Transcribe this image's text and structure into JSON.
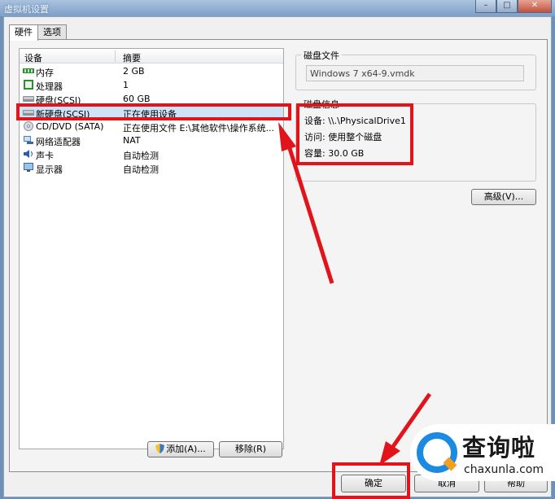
{
  "window": {
    "title": "虚拟机设置",
    "controls": {
      "minimize": "–",
      "maximize": "□",
      "close": "✕"
    }
  },
  "tabs": [
    {
      "label": "硬件",
      "active": true
    },
    {
      "label": "选项",
      "active": false
    }
  ],
  "device_list": {
    "headers": {
      "device": "设备",
      "summary": "摘要"
    },
    "rows": [
      {
        "icon": "memory-icon",
        "name": "内存",
        "summary": "2 GB"
      },
      {
        "icon": "processor-icon",
        "name": "处理器",
        "summary": "1"
      },
      {
        "icon": "hard-disk-icon",
        "name": "硬盘(SCSI)",
        "summary": "60 GB"
      },
      {
        "icon": "hard-disk-icon",
        "name": "新硬盘(SCSI)",
        "summary": "正在使用设备",
        "selected": true
      },
      {
        "icon": "cd-dvd-icon",
        "name": "CD/DVD (SATA)",
        "summary": "正在使用文件 E:\\其他软件\\操作系统..."
      },
      {
        "icon": "network-adapter-icon",
        "name": "网络适配器",
        "summary": "NAT"
      },
      {
        "icon": "sound-card-icon",
        "name": "声卡",
        "summary": "自动检测"
      },
      {
        "icon": "display-icon",
        "name": "显示器",
        "summary": "自动检测"
      }
    ]
  },
  "buttons": {
    "add": "添加(A)...",
    "remove": "移除(R)",
    "advanced": "高级(V)...",
    "ok": "确定",
    "cancel": "取消",
    "help": "帮助"
  },
  "disk_file": {
    "title": "磁盘文件",
    "value": "Windows 7 x64-9.vmdk"
  },
  "disk_info": {
    "title": "磁盘信息",
    "device": "设备:  \\\\.\\PhysicalDrive1",
    "access": "访问:  使用整个磁盘",
    "capacity": "容量:  30.0 GB"
  },
  "watermark": {
    "name": "查询啦",
    "domain": "chaxunla.com"
  },
  "colors": {
    "highlight": "#e2141b",
    "selection": "#cfe3f7",
    "logo_blue": "#1a8be0",
    "logo_orange": "#f4a01c"
  }
}
